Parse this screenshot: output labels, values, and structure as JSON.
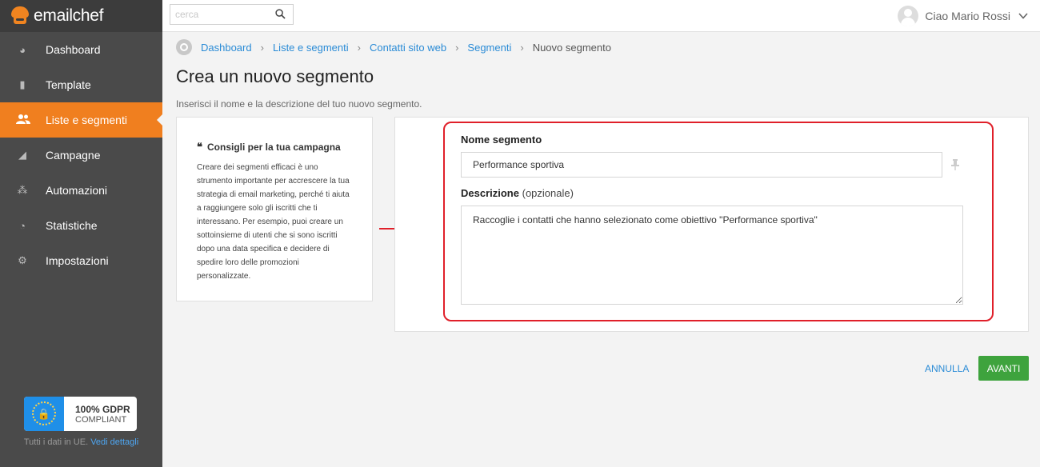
{
  "app": {
    "logo_text": "emailchef"
  },
  "colors": {
    "accent": "#f07f1f",
    "sidebar": "#4a4a4a",
    "link": "#2a8bd6",
    "primary_button": "#3ea33d",
    "highlight_border": "#e0202a"
  },
  "sidebar": {
    "items": [
      {
        "label": "Dashboard",
        "icon": "dashboard-icon"
      },
      {
        "label": "Template",
        "icon": "document-icon"
      },
      {
        "label": "Liste e segmenti",
        "icon": "users-icon",
        "active": true
      },
      {
        "label": "Campagne",
        "icon": "paper-plane-icon"
      },
      {
        "label": "Automazioni",
        "icon": "flow-icon"
      },
      {
        "label": "Statistiche",
        "icon": "pie-chart-icon"
      },
      {
        "label": "Impostazioni",
        "icon": "gears-icon"
      }
    ],
    "gdpr_badge": {
      "title": "100% GDPR",
      "subtitle": "COMPLIANT"
    },
    "gdpr_note": "Tutti i dati in UE.",
    "gdpr_link": "Vedi dettagli"
  },
  "topbar": {
    "search_placeholder": "cerca",
    "user_greeting": "Ciao Mario Rossi"
  },
  "breadcrumb": [
    "Dashboard",
    "Liste e segmenti",
    "Contatti sito web",
    "Segmenti",
    "Nuovo segmento"
  ],
  "page": {
    "title": "Crea un nuovo segmento",
    "subtitle": "Inserisci il nome e la descrizione del tuo nuovo segmento."
  },
  "tips": {
    "title": "Consigli per la tua campagna",
    "body": "Creare dei segmenti efficaci è uno strumento importante per accrescere la tua strategia di email marketing, perché ti aiuta a raggiungere solo gli iscritti che ti interessano. Per esempio, puoi creare un sottoinsieme di utenti che si sono iscritti dopo una data specifica e decidere di spedire loro delle promozioni personalizzate."
  },
  "form": {
    "name_label": "Nome segmento",
    "name_value": "Performance sportiva",
    "description_label": "Descrizione",
    "description_optional": "(opzionale)",
    "description_value": "Raccoglie i contatti che hanno selezionato come obiettivo \"Performance sportiva\""
  },
  "actions": {
    "cancel": "ANNULLA",
    "next": "AVANTI"
  }
}
